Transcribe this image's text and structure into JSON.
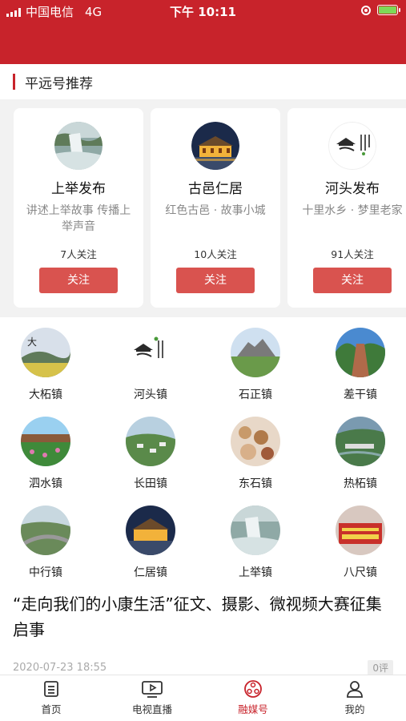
{
  "status_bar": {
    "carrier": "中国电信",
    "network": "4G",
    "time": "下午 10:11"
  },
  "section": {
    "title": "平远号推荐"
  },
  "recommend_cards": [
    {
      "name": "上举发布",
      "desc": "讲述上举故事 传播上举声音",
      "followers": "7人关注",
      "follow_label": "关注"
    },
    {
      "name": "古邑仁居",
      "desc": "红色古邑 · 故事小城",
      "followers": "10人关注",
      "follow_label": "关注"
    },
    {
      "name": "河头发布",
      "desc": "十里水乡 · 梦里老家",
      "followers": "91人关注",
      "follow_label": "关注"
    }
  ],
  "towns": [
    "大柘镇",
    "河头镇",
    "石正镇",
    "差干镇",
    "泗水镇",
    "长田镇",
    "东石镇",
    "热柘镇",
    "中行镇",
    "仁居镇",
    "上举镇",
    "八尺镇"
  ],
  "article": {
    "title": "“走向我们的小康生活”征文、摄影、微视频大赛征集启事",
    "date": "2020-07-23 18:55",
    "comments": "0评"
  },
  "tabbar": {
    "items": [
      {
        "label": "首页",
        "icon": "home-doc-icon",
        "active": false
      },
      {
        "label": "电视直播",
        "icon": "tv-play-icon",
        "active": false
      },
      {
        "label": "融媒号",
        "icon": "media-icon",
        "active": true
      },
      {
        "label": "我的",
        "icon": "user-icon",
        "active": false
      }
    ]
  },
  "colors": {
    "brand_red": "#c8232b",
    "button_red": "#d9534f"
  }
}
